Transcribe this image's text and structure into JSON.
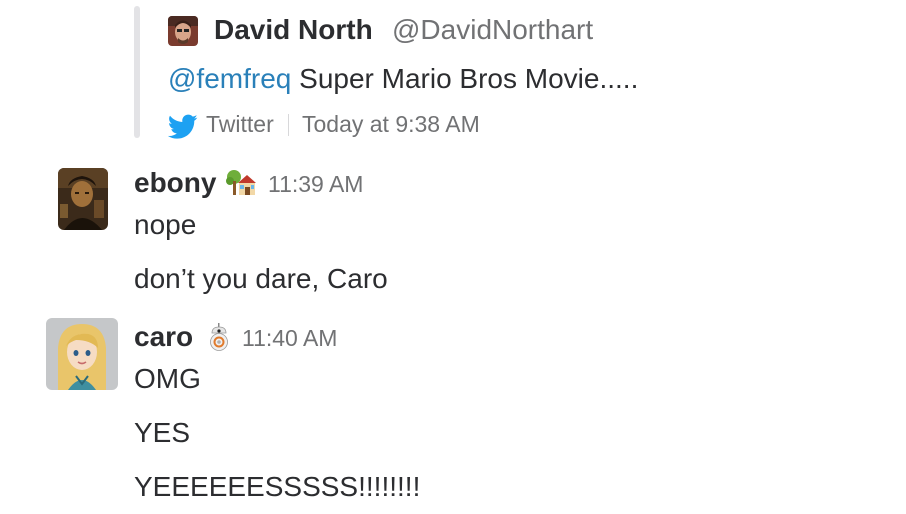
{
  "attachment": {
    "author_name": "David North",
    "author_handle": "@DavidNorthart",
    "mention": "@femfreq",
    "text": " Super Mario Bros Movie.....",
    "service_icon": "twitter-bird-icon",
    "service_name": "Twitter",
    "time": "Today at 9:38 AM",
    "accent_color": "#2a80b9",
    "bar_color": "#e3e3e6"
  },
  "messages": [
    {
      "username": "ebony",
      "status_emoji": "house-with-garden-emoji",
      "time": "11:39 AM",
      "lines": [
        "nope",
        "don’t you dare, Caro"
      ]
    },
    {
      "username": "caro",
      "status_emoji": "bb8-droid-emoji",
      "time": "11:40 AM",
      "lines": [
        "OMG",
        "YES",
        "YEEEEEESSSSS!!!!!!!!"
      ]
    }
  ],
  "colors": {
    "text": "#2c2d30",
    "muted": "#717274",
    "twitter_blue": "#1da1f2"
  }
}
